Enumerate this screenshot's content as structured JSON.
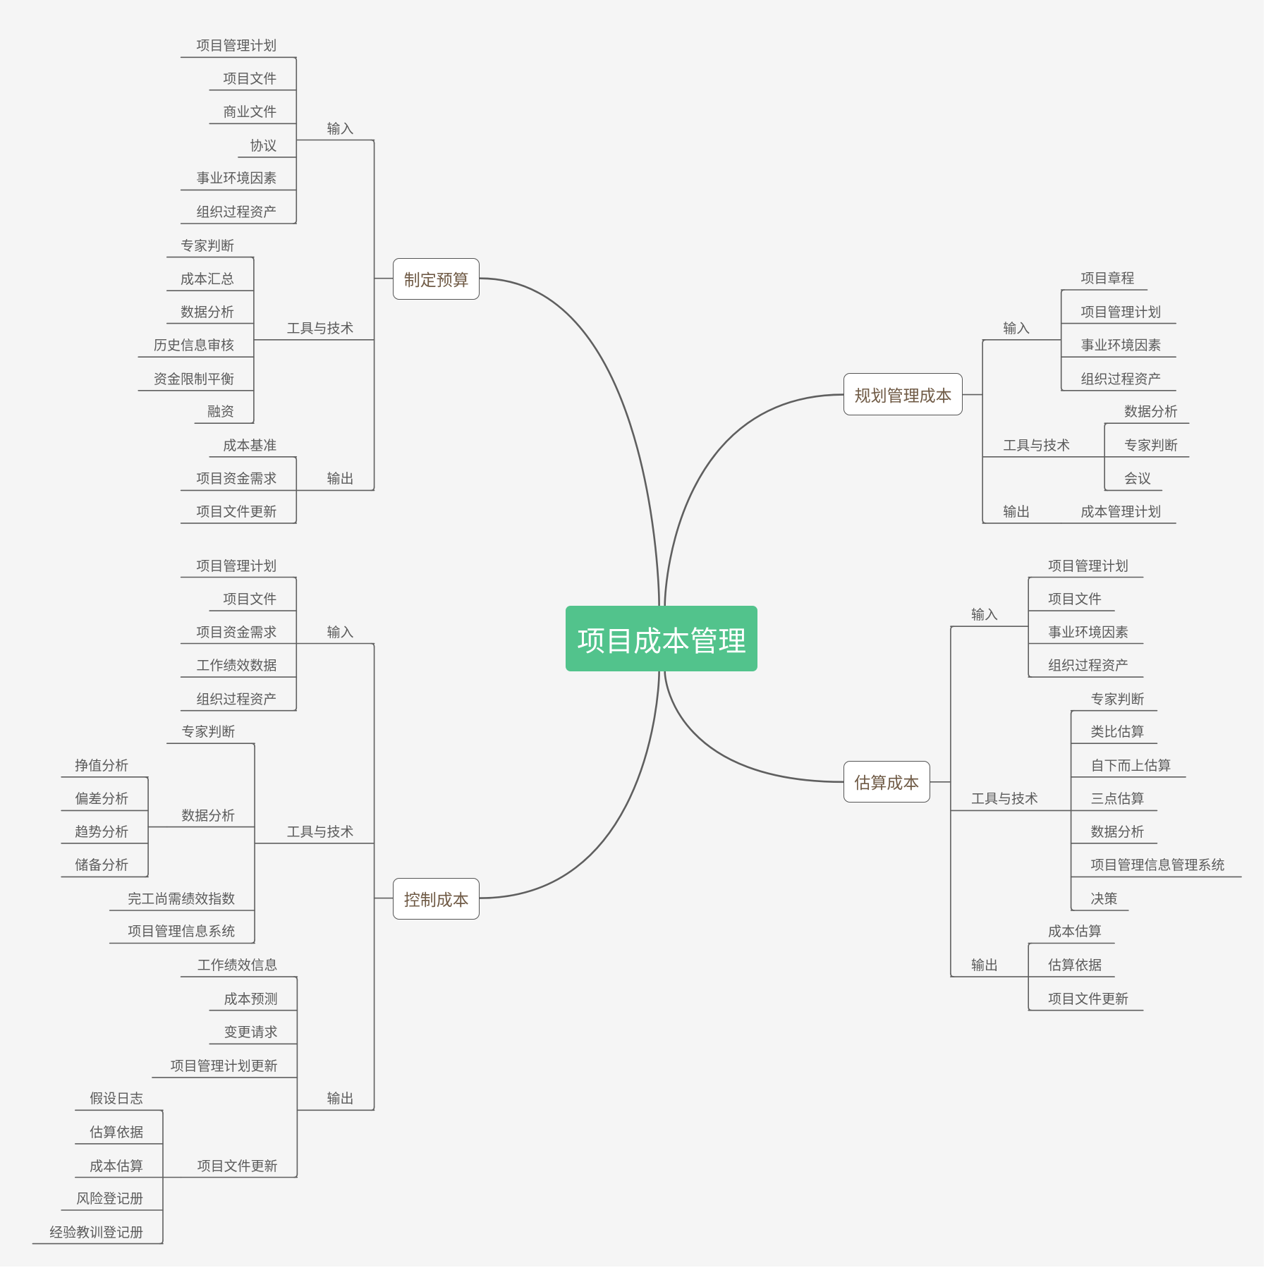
{
  "root": {
    "label": "项目成本管理",
    "color": "#52c38c"
  },
  "branches": [
    {
      "id": "plan-budget",
      "label": "制定预算",
      "groups": [
        {
          "label": "输入",
          "items": [
            {
              "label": "项目管理计划"
            },
            {
              "label": "项目文件"
            },
            {
              "label": "商业文件"
            },
            {
              "label": "协议"
            },
            {
              "label": "事业环境因素"
            },
            {
              "label": "组织过程资产"
            }
          ]
        },
        {
          "label": "工具与技术",
          "items": [
            {
              "label": "专家判断"
            },
            {
              "label": "成本汇总"
            },
            {
              "label": "数据分析"
            },
            {
              "label": "历史信息审核"
            },
            {
              "label": "资金限制平衡"
            },
            {
              "label": "融资"
            }
          ]
        },
        {
          "label": "输出",
          "items": [
            {
              "label": "成本基准"
            },
            {
              "label": "项目资金需求"
            },
            {
              "label": "项目文件更新"
            }
          ]
        }
      ]
    },
    {
      "id": "plan-cost-mgmt",
      "label": "规划管理成本",
      "groups": [
        {
          "label": "输入",
          "items": [
            {
              "label": "项目章程"
            },
            {
              "label": "项目管理计划"
            },
            {
              "label": "事业环境因素"
            },
            {
              "label": "组织过程资产"
            }
          ]
        },
        {
          "label": "工具与技术",
          "items": [
            {
              "label": "数据分析"
            },
            {
              "label": "专家判断"
            },
            {
              "label": "会议"
            }
          ]
        },
        {
          "label": "输出",
          "items": [
            {
              "label": "成本管理计划"
            }
          ]
        }
      ]
    },
    {
      "id": "estimate-cost",
      "label": "估算成本",
      "groups": [
        {
          "label": "输入",
          "items": [
            {
              "label": "项目管理计划"
            },
            {
              "label": "项目文件"
            },
            {
              "label": "事业环境因素"
            },
            {
              "label": "组织过程资产"
            }
          ]
        },
        {
          "label": "工具与技术",
          "items": [
            {
              "label": "专家判断"
            },
            {
              "label": "类比估算"
            },
            {
              "label": "自下而上估算"
            },
            {
              "label": "三点估算"
            },
            {
              "label": "数据分析"
            },
            {
              "label": "项目管理信息管理系统"
            },
            {
              "label": "决策"
            }
          ]
        },
        {
          "label": "输出",
          "items": [
            {
              "label": "成本估算"
            },
            {
              "label": "估算依据"
            },
            {
              "label": "项目文件更新"
            }
          ]
        }
      ]
    },
    {
      "id": "control-cost",
      "label": "控制成本",
      "groups": [
        {
          "label": "输入",
          "items": [
            {
              "label": "项目管理计划"
            },
            {
              "label": "项目文件"
            },
            {
              "label": "项目资金需求"
            },
            {
              "label": "工作绩效数据"
            },
            {
              "label": "组织过程资产"
            }
          ]
        },
        {
          "label": "工具与技术",
          "items": [
            {
              "label": "专家判断"
            },
            {
              "label": "数据分析",
              "items": [
                {
                  "label": "挣值分析"
                },
                {
                  "label": "偏差分析"
                },
                {
                  "label": "趋势分析"
                },
                {
                  "label": "储备分析"
                }
              ]
            },
            {
              "label": "完工尚需绩效指数"
            },
            {
              "label": "项目管理信息系统"
            }
          ]
        },
        {
          "label": "输出",
          "items": [
            {
              "label": "工作绩效信息"
            },
            {
              "label": "成本预测"
            },
            {
              "label": "变更请求"
            },
            {
              "label": "项目管理计划更新"
            },
            {
              "label": "项目文件更新",
              "items": [
                {
                  "label": "假设日志"
                },
                {
                  "label": "估算依据"
                },
                {
                  "label": "成本估算"
                },
                {
                  "label": "风险登记册"
                },
                {
                  "label": "经验教训登记册"
                }
              ]
            }
          ]
        }
      ]
    }
  ]
}
